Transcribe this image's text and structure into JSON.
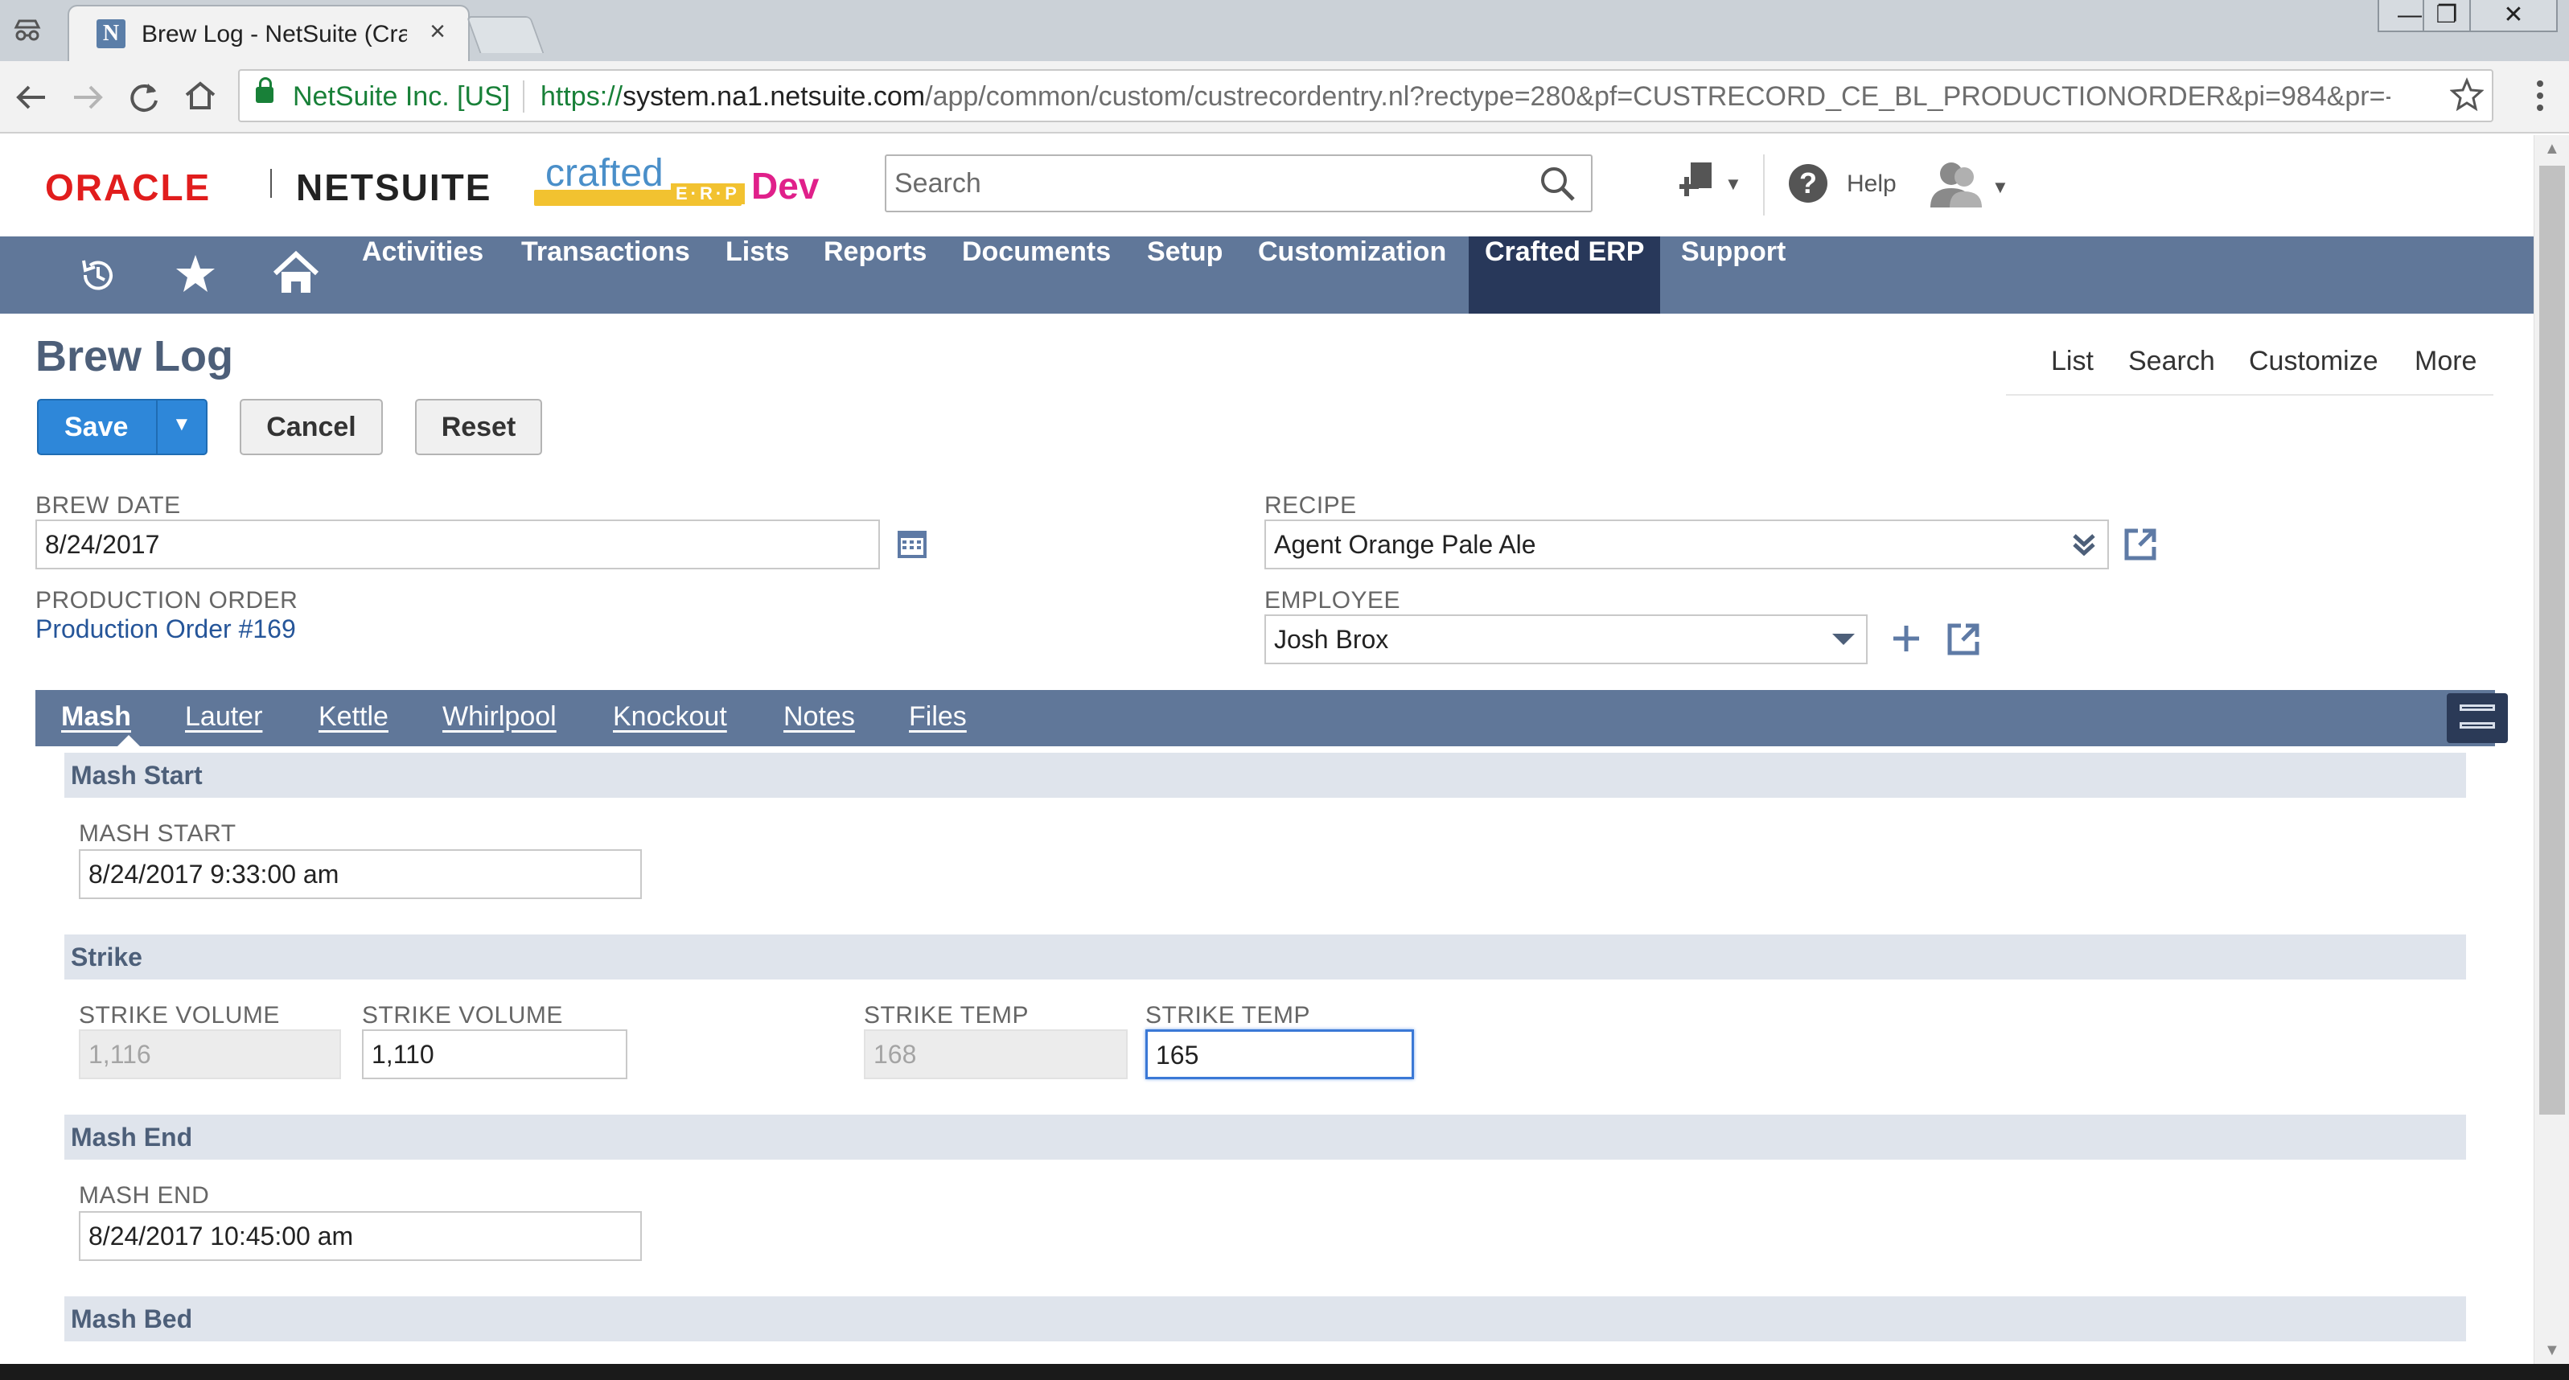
{
  "browser": {
    "tab_title": "Brew Log - NetSuite (Cra",
    "tab_close": "×",
    "window_buttons": [
      "—",
      "❐",
      "✕"
    ],
    "secure_label": "NetSuite Inc. [US]",
    "url_scheme": "https://",
    "url_host": "system.na1.netsuite.com",
    "url_path": "/app/common/custom/custrecordentry.nl?rectype=280&pf=CUSTRECORD_CE_BL_PRODUCTIONORDER&pi=984&pr=-..."
  },
  "header": {
    "oracle": "ORACLE",
    "netsuite": "NETSUITE",
    "crafted": "crafted",
    "erp": "E·R·P",
    "dev": "Dev",
    "search_placeholder": "Search",
    "help": "Help"
  },
  "nav": {
    "items": [
      "Activities",
      "Transactions",
      "Lists",
      "Reports",
      "Documents",
      "Setup",
      "Customization",
      "Crafted ERP",
      "Support"
    ],
    "active": "Crafted ERP"
  },
  "page": {
    "title": "Brew Log",
    "links": [
      "List",
      "Search",
      "Customize",
      "More"
    ]
  },
  "buttons": {
    "save": "Save",
    "cancel": "Cancel",
    "reset": "Reset"
  },
  "form": {
    "brew_date_label": "BREW DATE",
    "brew_date": "8/24/2017",
    "production_order_label": "PRODUCTION ORDER",
    "production_order": "Production Order #169",
    "recipe_label": "RECIPE",
    "recipe": "Agent Orange Pale Ale",
    "employee_label": "EMPLOYEE",
    "employee": "Josh Brox"
  },
  "subtabs": [
    "Mash",
    "Lauter",
    "Kettle",
    "Whirlpool",
    "Knockout",
    "Notes",
    "Files"
  ],
  "mash": {
    "mash_start_section": "Mash Start",
    "mash_start_label": "MASH START",
    "mash_start": "8/24/2017  9:33:00 am",
    "strike_section": "Strike",
    "strike_volume_label": "STRIKE VOLUME",
    "strike_volume_planned": "1,116",
    "strike_volume_actual": "1,110",
    "strike_temp_label": "STRIKE TEMP",
    "strike_temp_planned": "168",
    "strike_temp_actual": "165",
    "mash_end_section": "Mash End",
    "mash_end_label": "MASH END",
    "mash_end": "8/24/2017  10:45:00 am",
    "mash_bed_section": "Mash Bed"
  },
  "colors": {
    "nav_bg": "#607799",
    "nav_active": "#28385a",
    "save_blue": "#2e87d9",
    "title_slate": "#4d5f79",
    "section_bg": "#dfe4ec",
    "oracle_red": "#e11d1d",
    "dev_magenta": "#e0208a"
  },
  "icons": [
    "incognito-icon",
    "netsuite-favicon",
    "back-icon",
    "forward-icon",
    "reload-icon",
    "home-icon",
    "lock-icon",
    "star-icon",
    "menu-icon",
    "search-icon",
    "create-new-icon",
    "help-icon",
    "user-avatar-icon",
    "recent-records-icon",
    "favorites-star-icon",
    "home-nav-icon",
    "calendar-icon",
    "double-chevron-icon",
    "open-record-icon",
    "add-icon",
    "dropdown-arrow-icon",
    "layout-toggle-icon"
  ]
}
